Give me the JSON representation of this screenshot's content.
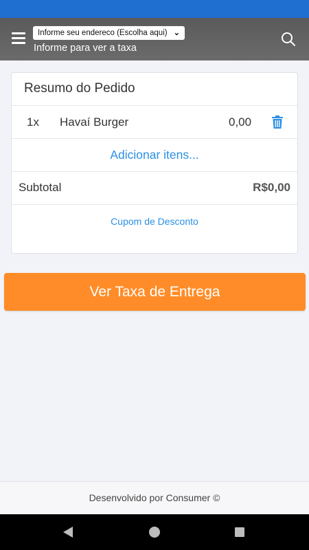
{
  "header": {
    "address_select": "Informe seu endereco (Escolha aqui)",
    "address_subtitle": "Informe para ver a taxa"
  },
  "order": {
    "title": "Resumo do Pedido",
    "items": [
      {
        "qty": "1x",
        "name": "Havaí Burger",
        "price": "0,00"
      }
    ],
    "add_items_label": "Adicionar itens...",
    "subtotal_label": "Subtotal",
    "subtotal_value": "R$0,00",
    "coupon_label": "Cupom de Desconto"
  },
  "cta": {
    "label": "Ver Taxa de Entrega"
  },
  "footer": {
    "text": "Desenvolvido por Consumer ©"
  },
  "icons": [
    "menu-icon",
    "chevron-down-icon",
    "search-icon",
    "trash-icon",
    "back-icon",
    "home-icon",
    "recents-icon"
  ],
  "colors": {
    "status_bar": "#1f6fd1",
    "header": "#666666",
    "link": "#2b8fe4",
    "cta": "#ff8c28"
  }
}
